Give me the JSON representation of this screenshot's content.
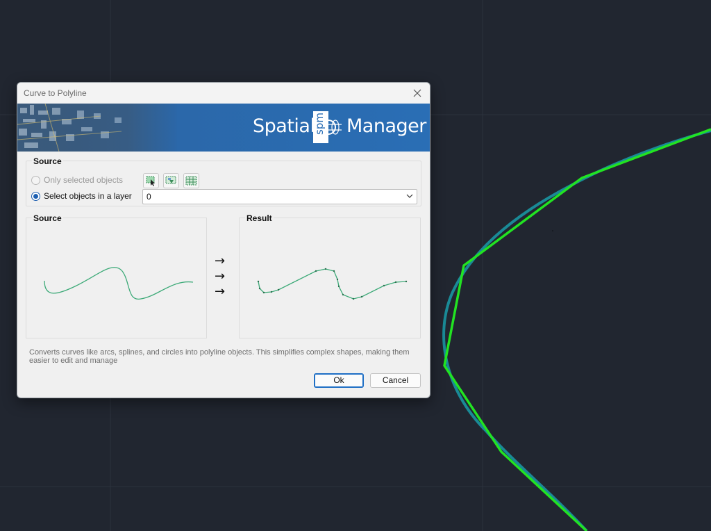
{
  "dialog": {
    "title": "Curve to Polyline",
    "close_icon": "close-icon"
  },
  "banner": {
    "logo_left": "Spatial",
    "logo_badge": "spm",
    "logo_right": "Manager"
  },
  "source_group": {
    "label": "Source",
    "option_selected": "Only selected objects",
    "option_layer": "Select objects in a layer",
    "selected_option": "layer",
    "tool_icons": [
      "select-objects-icon",
      "select-by-polygon-icon",
      "select-by-window-icon"
    ],
    "layer_value": "0"
  },
  "preview": {
    "source_label": "Source",
    "result_label": "Result",
    "arrows": [
      "→",
      "→",
      "→"
    ]
  },
  "description": "Converts curves like arcs, splines, and circles into polyline objects. This simplifies complex shapes, making them easier to edit and manage",
  "buttons": {
    "ok": "Ok",
    "cancel": "Cancel"
  },
  "colors": {
    "cad_background": "#212630",
    "curve_cyan": "#1a8a96",
    "polyline_green": "#22e322",
    "preview_line": "#3daa78",
    "accent_blue": "#1d5fb1"
  }
}
